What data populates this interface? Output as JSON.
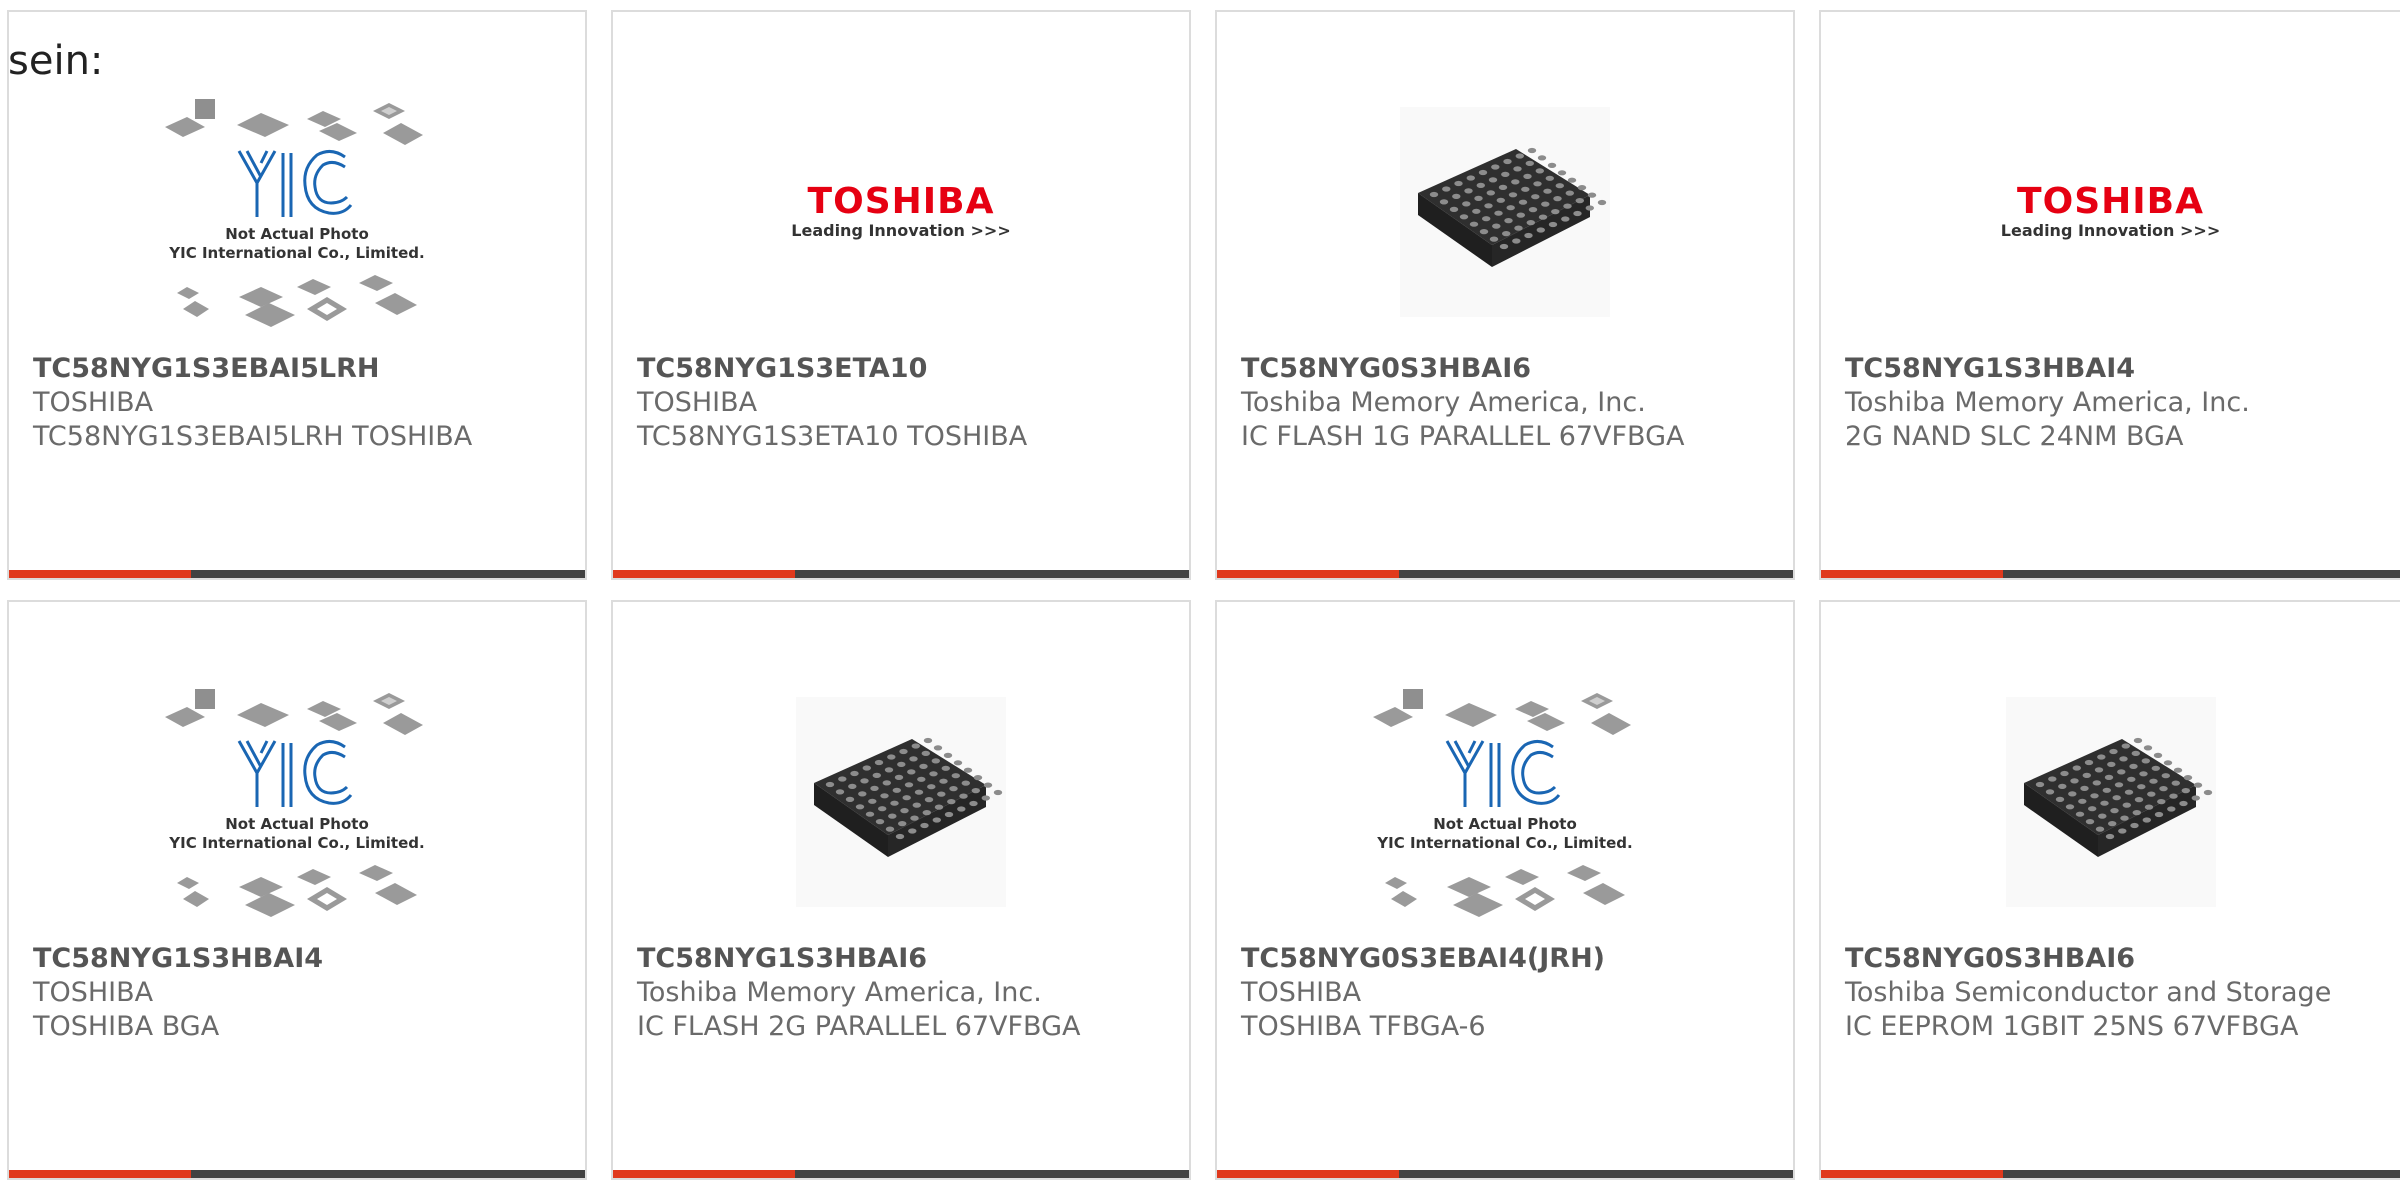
{
  "intro_text": "sein:",
  "placeholder_caption": {
    "line1": "Not Actual Photo",
    "line2": "YIC International Co., Limited."
  },
  "toshiba_logo": {
    "brand": "TOSHIBA",
    "tagline": "Leading Innovation >>>"
  },
  "colors": {
    "accent": "#e0391d",
    "bar": "#424242",
    "toshiba_red": "#e60012",
    "yic_blue": "#1a66b3"
  },
  "products": [
    {
      "image": "yic-placeholder",
      "part_number": "TC58NYG1S3EBAI5LRH",
      "manufacturer": "TOSHIBA",
      "description": "TC58NYG1S3EBAI5LRH TOSHIBA"
    },
    {
      "image": "toshiba-logo",
      "part_number": "TC58NYG1S3ETA10",
      "manufacturer": "TOSHIBA",
      "description": "TC58NYG1S3ETA10 TOSHIBA"
    },
    {
      "image": "bga-chip",
      "part_number": "TC58NYG0S3HBAI6",
      "manufacturer": "Toshiba Memory America, Inc.",
      "description": "IC FLASH 1G PARALLEL 67VFBGA"
    },
    {
      "image": "toshiba-logo",
      "part_number": "TC58NYG1S3HBAI4",
      "manufacturer": "Toshiba Memory America, Inc.",
      "description": "2G NAND SLC 24NM BGA"
    },
    {
      "image": "yic-placeholder",
      "part_number": "TC58NYG1S3HBAI4",
      "manufacturer": "TOSHIBA",
      "description": "TOSHIBA BGA"
    },
    {
      "image": "bga-chip",
      "part_number": "TC58NYG1S3HBAI6",
      "manufacturer": "Toshiba Memory America, Inc.",
      "description": "IC FLASH 2G PARALLEL 67VFBGA"
    },
    {
      "image": "yic-placeholder",
      "part_number": "TC58NYG0S3EBAI4(JRH)",
      "manufacturer": "TOSHIBA",
      "description": "TOSHIBA TFBGA-6"
    },
    {
      "image": "bga-chip",
      "part_number": "TC58NYG0S3HBAI6",
      "manufacturer": "Toshiba Semiconductor and Storage",
      "description": "IC EEPROM 1GBIT 25NS 67VFBGA"
    }
  ]
}
